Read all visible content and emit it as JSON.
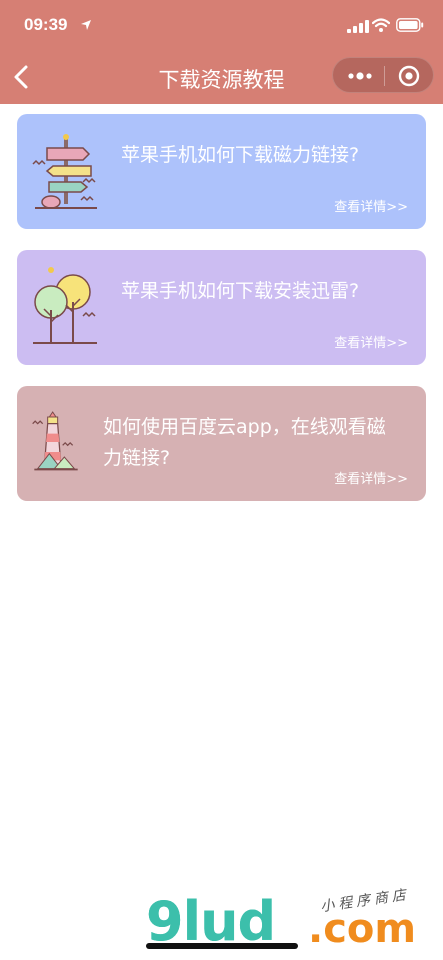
{
  "status_bar": {
    "time": "09:39"
  },
  "nav": {
    "title": "下载资源教程"
  },
  "cards": [
    {
      "title": "苹果手机如何下载磁力链接?",
      "link": "查看详情>>",
      "bg": "#adc2fb",
      "icon": "signpost-icon"
    },
    {
      "title": "苹果手机如何下载安装迅雷?",
      "link": "查看详情>>",
      "bg": "#ccbdf2",
      "icon": "trees-icon"
    },
    {
      "title": "如何使用百度云app，在线观看磁力链接?",
      "link": "查看详情>>",
      "bg": "#d6b1b3",
      "icon": "lighthouse-icon"
    }
  ],
  "watermark": {
    "logo": "9lud",
    "suffix": ".com",
    "tagline": "小程序商店"
  },
  "colors": {
    "header": "#d67f74"
  }
}
